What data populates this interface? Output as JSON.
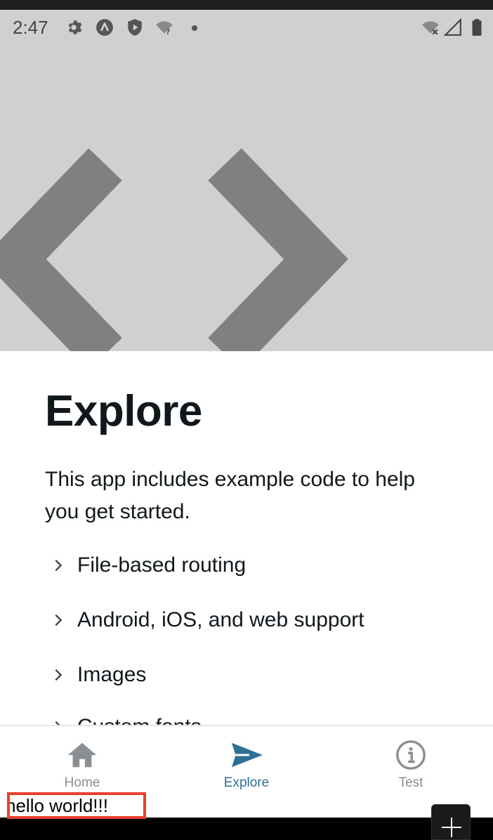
{
  "status_bar": {
    "time": "2:47"
  },
  "page": {
    "title": "Explore",
    "description": "This app includes example code to help you get started."
  },
  "collapsibles": [
    {
      "label": "File-based routing"
    },
    {
      "label": "Android, iOS, and web support"
    },
    {
      "label": "Images"
    },
    {
      "label": "Custom fonts"
    }
  ],
  "tabs": [
    {
      "label": "Home",
      "icon": "house-icon"
    },
    {
      "label": "Explore",
      "icon": "paper-plane-icon",
      "active": true
    },
    {
      "label": "Test",
      "icon": "info-circle-icon"
    }
  ],
  "overlay": {
    "hello_text": "hello world!!!"
  },
  "colors": {
    "hero_bg": "#d0d0d0",
    "hero_glyph": "#808080",
    "active_tab": "#2e6f96",
    "inactive_tab": "#8a8f94",
    "highlight_border": "#e8402c"
  }
}
